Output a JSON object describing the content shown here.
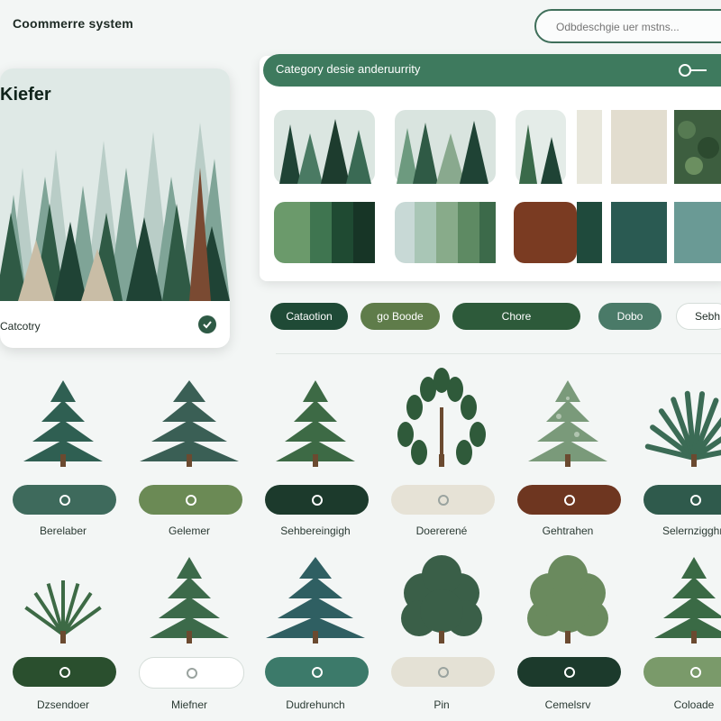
{
  "header": {
    "brand": "Coommerre system",
    "search_placeholder": "Odbdeschgie uer mstns..."
  },
  "featured_card": {
    "title": "Kiefer",
    "category_label": "Catcotry"
  },
  "category_panel": {
    "title": "Category desie anderuurrity"
  },
  "filter_chips": [
    {
      "label": "Cataotion",
      "bg": "#1f4a36",
      "fg": "#ffffff"
    },
    {
      "label": "go Boode",
      "bg": "#5f7c4a",
      "fg": "#ffffff"
    },
    {
      "label": "Chore",
      "bg": "#2d5a3a",
      "fg": "#ffffff"
    },
    {
      "label": "Dobo",
      "bg": "#4a7a68",
      "fg": "#ffffff"
    },
    {
      "label": "Sebh",
      "bg": "#ffffff",
      "fg": "#1d2a24"
    }
  ],
  "tree_row1": [
    {
      "label": "Berelaber",
      "pill": "#3e6a5c",
      "icon": "shield-icon"
    },
    {
      "label": "Gelemer",
      "pill": "#6b8a55",
      "icon": "leaf-icon"
    },
    {
      "label": "Sehbereingigh",
      "pill": "#1c3a2c",
      "icon": "circle-icon"
    },
    {
      "label": "Doererené",
      "pill": "#e6e2d6",
      "icon": "circle-icon"
    },
    {
      "label": "Gehtrahen",
      "pill": "#6e3620",
      "icon": "hand-icon"
    },
    {
      "label": "Selernzigghn",
      "pill": "#2f5a4c",
      "icon": "circle-icon"
    }
  ],
  "tree_row2": [
    {
      "label": "Dzsendoer",
      "pill": "#2a4f2e",
      "icon": "circle-icon"
    },
    {
      "label": "Miefner",
      "pill": "#ffffff",
      "icon": "square-icon"
    },
    {
      "label": "Dudrehunch",
      "pill": "#3c7a6a",
      "icon": "circle-icon"
    },
    {
      "label": "Pin",
      "pill": "#e4e1d5",
      "icon": "circle-icon"
    },
    {
      "label": "Cemelsrv",
      "pill": "#1c3a2c",
      "icon": "circle-icon"
    },
    {
      "label": "Coloade",
      "pill": "#7a9a6a",
      "icon": "circle-icon"
    }
  ]
}
